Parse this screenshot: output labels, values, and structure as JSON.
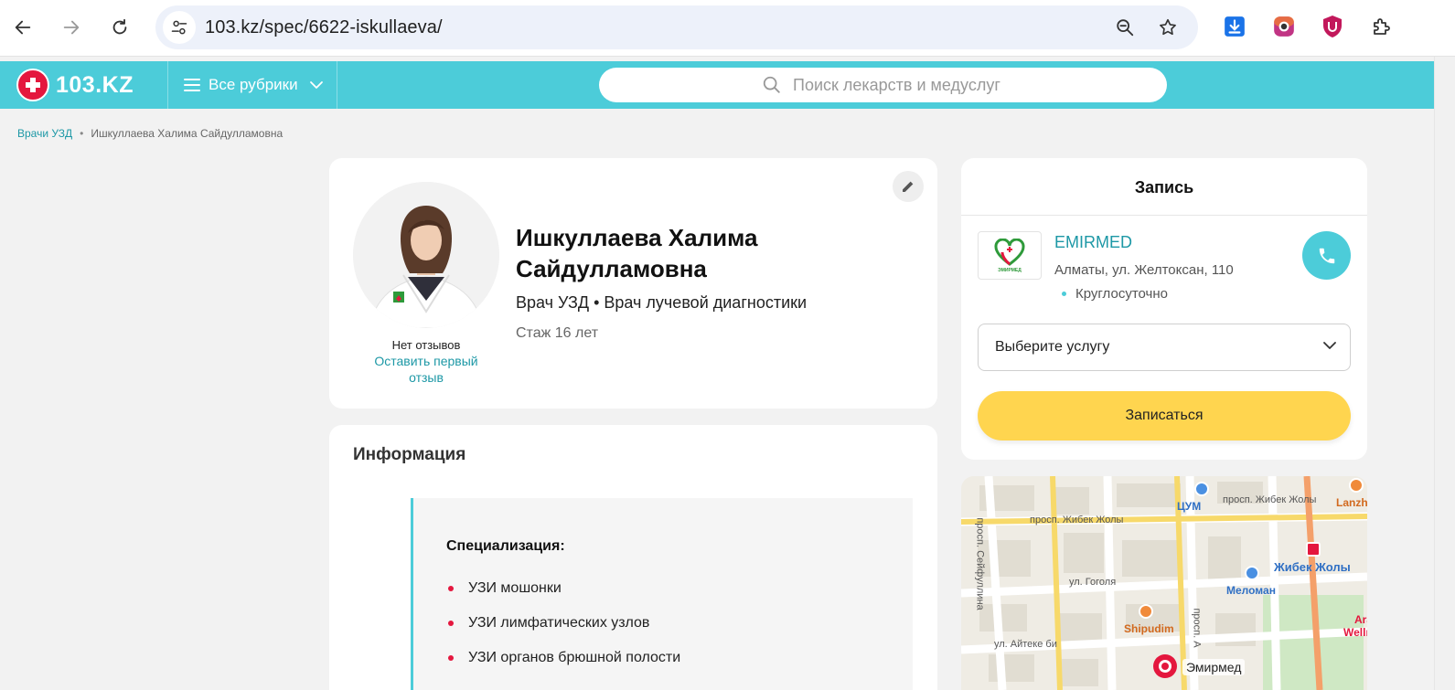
{
  "browser": {
    "url": "103.kz/spec/6622-iskullaeva/"
  },
  "header": {
    "logo_text": "103.KZ",
    "rubrics_label": "Все рубрики",
    "search_placeholder": "Поиск лекарств и медуслуг"
  },
  "breadcrumb": {
    "parent": "Врачи УЗД",
    "current": "Ишкуллаева Халима Сайдулламовна"
  },
  "profile": {
    "name": "Ишкуллаева Халима Сайдулламовна",
    "specialties": "Врач УЗД • Врач лучевой диагностики",
    "experience": "Стаж 16 лет",
    "reviews_status": "Нет отзывов",
    "leave_review": "Оставить первый отзыв"
  },
  "info": {
    "title": "Информация",
    "spec_title": "Специализация:",
    "spec_items": [
      "УЗИ мошонки",
      "УЗИ лимфатических узлов",
      "УЗИ органов брюшной полости"
    ]
  },
  "booking": {
    "title": "Запись",
    "clinic_name": "EMIRMED",
    "clinic_logo_text": "ЭМИРМЕД",
    "clinic_address": "Алматы, ул. Желтоксан, 110",
    "clinic_hours": "Круглосуточно",
    "service_placeholder": "Выберите услугу",
    "book_button": "Записаться"
  },
  "map": {
    "streets": [
      "просп. Жибек Жолы",
      "просп. Жибек Жолы",
      "просп. Сейфуллина",
      "ул. Гоголя",
      "ул. Айтеке би",
      "просп. А"
    ],
    "pois": [
      "ЦУМ",
      "Жибек Жолы",
      "Меломан",
      "Shipudim",
      "Lanzho",
      "Ara",
      "Wellne"
    ],
    "marker_label": "Эмирмед"
  },
  "colors": {
    "brand": "#4cccd9",
    "accent_red": "#e4173e",
    "link": "#1d98a6",
    "book_button": "#ffd54f"
  }
}
